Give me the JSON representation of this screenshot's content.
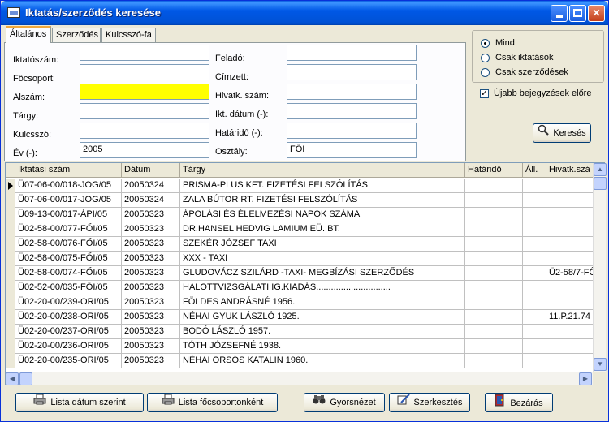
{
  "window": {
    "title": "Iktatás/szerződés keresése"
  },
  "tabs": [
    {
      "label": "Általános"
    },
    {
      "label": "Szerződés"
    },
    {
      "label": "Kulcsszó-fa"
    }
  ],
  "form": {
    "iktatoszam": {
      "label": "Iktatószám:",
      "value": ""
    },
    "focsoport": {
      "label": "Főcsoport:",
      "value": ""
    },
    "alszam": {
      "label": "Alszám:",
      "value": ""
    },
    "targy": {
      "label": "Tárgy:",
      "value": ""
    },
    "kulcsszo": {
      "label": "Kulcsszó:",
      "value": ""
    },
    "ev": {
      "label": "Év (-):",
      "value": "2005"
    },
    "felado": {
      "label": "Feladó:",
      "value": ""
    },
    "cimzett": {
      "label": "Címzett:",
      "value": ""
    },
    "hivatk": {
      "label": "Hivatk. szám:",
      "value": ""
    },
    "ikt_datum": {
      "label": "Ikt. dátum (-):",
      "value": ""
    },
    "hatarido": {
      "label": "Határidő (-):",
      "value": ""
    },
    "osztaly": {
      "label": "Osztály:",
      "value": "FŐI"
    }
  },
  "options": {
    "radios": [
      {
        "label": "Mind",
        "selected": true
      },
      {
        "label": "Csak iktatások",
        "selected": false
      },
      {
        "label": "Csak szerződések",
        "selected": false
      }
    ],
    "newer_first": {
      "label": "Újabb bejegyzések előre",
      "checked": true
    }
  },
  "search_button": "Keresés",
  "grid": {
    "columns": [
      "Iktatási szám",
      "Dátum",
      "Tárgy",
      "Határidő",
      "Áll.",
      "Hivatk.szá"
    ],
    "rows": [
      [
        "Ü07-06-00/018-JOG/05",
        "20050324",
        "PRISMA-PLUS KFT. FIZETÉSI FELSZÓLÍTÁS",
        "",
        "",
        ""
      ],
      [
        "Ü07-06-00/017-JOG/05",
        "20050324",
        "ZALA BÚTOR RT. FIZETÉSI FELSZÓLÍTÁS",
        "",
        "",
        ""
      ],
      [
        "Ü09-13-00/017-ÁPI/05",
        "20050323",
        "ÁPOLÁSI ÉS ÉLELMEZÉSI NAPOK SZÁMA",
        "",
        "",
        ""
      ],
      [
        "Ü02-58-00/077-FŐI/05",
        "20050323",
        "DR.HANSEL HEDVIG LAMIUM EÜ. BT.",
        "",
        "",
        ""
      ],
      [
        "Ü02-58-00/076-FŐI/05",
        "20050323",
        "SZEKÉR JÓZSEF TAXI",
        "",
        "",
        ""
      ],
      [
        "Ü02-58-00/075-FŐI/05",
        "20050323",
        "XXX - TAXI",
        "",
        "",
        ""
      ],
      [
        "Ü02-58-00/074-FŐI/05",
        "20050323",
        "GLUDOVÁCZ SZILÁRD -TAXI- MEGBÍZÁSI SZERZŐDÉS",
        "",
        "",
        "Ü2-58/7-FŐ"
      ],
      [
        "Ü02-52-00/035-FŐI/05",
        "20050323",
        "HALOTTVIZSGÁLATI IG.KIADÁS..............................",
        "",
        "",
        ""
      ],
      [
        "Ü02-20-00/239-ORI/05",
        "20050323",
        "FÖLDES ANDRÁSNÉ 1956.",
        "",
        "",
        ""
      ],
      [
        "Ü02-20-00/238-ORI/05",
        "20050323",
        "NÉHAI GYUK LÁSZLÓ 1925.",
        "",
        "",
        "11.P.21.74"
      ],
      [
        "Ü02-20-00/237-ORI/05",
        "20050323",
        "BODÓ LÁSZLÓ 1957.",
        "",
        "",
        ""
      ],
      [
        "Ü02-20-00/236-ORI/05",
        "20050323",
        "TÓTH JÓZSEFNÉ 1938.",
        "",
        "",
        ""
      ],
      [
        "Ü02-20-00/235-ORI/05",
        "20050323",
        "NÉHAI  ORSÓS KATALIN 1960.",
        "",
        "",
        ""
      ]
    ]
  },
  "buttons": {
    "lista_datum": "Lista dátum szerint",
    "lista_focsoport": "Lista főcsoportonként",
    "gyorsnezet": "Gyorsnézet",
    "szerkesztes": "Szerkesztés",
    "bezaras": "Bezárás"
  }
}
